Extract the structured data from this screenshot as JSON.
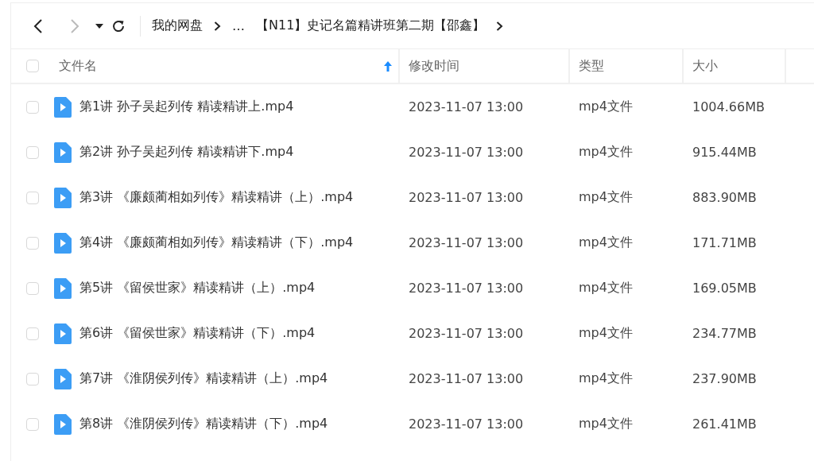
{
  "toolbar": {
    "back": {
      "disabled": false
    },
    "forward": {
      "disabled": true
    }
  },
  "breadcrumb": {
    "items": [
      "我的网盘",
      "…",
      "【N11】史记名篇精讲班第二期【邵鑫】"
    ]
  },
  "table": {
    "select_all": {
      "checked": false
    },
    "columns": [
      {
        "label": "文件名",
        "sorted": true
      },
      {
        "label": "修改时间",
        "sorted": false
      },
      {
        "label": "类型",
        "sorted": false
      },
      {
        "label": "大小",
        "sorted": false
      }
    ],
    "rows": [
      {
        "checked": false,
        "name": "第1讲 孙子吴起列传 精读精讲上.mp4",
        "modified": "2023-11-07 13:00",
        "type": "mp4文件",
        "size": "1004.66MB"
      },
      {
        "checked": false,
        "name": "第2讲 孙子吴起列传 精读精讲下.mp4",
        "modified": "2023-11-07 13:00",
        "type": "mp4文件",
        "size": "915.44MB"
      },
      {
        "checked": false,
        "name": "第3讲 《廉颇蔺相如列传》精读精讲（上）.mp4",
        "modified": "2023-11-07 13:00",
        "type": "mp4文件",
        "size": "883.90MB"
      },
      {
        "checked": false,
        "name": "第4讲 《廉颇蔺相如列传》精读精讲（下）.mp4",
        "modified": "2023-11-07 13:00",
        "type": "mp4文件",
        "size": "171.71MB"
      },
      {
        "checked": false,
        "name": "第5讲 《留侯世家》精读精讲（上）.mp4",
        "modified": "2023-11-07 13:00",
        "type": "mp4文件",
        "size": "169.05MB"
      },
      {
        "checked": false,
        "name": "第6讲 《留侯世家》精读精讲（下）.mp4",
        "modified": "2023-11-07 13:00",
        "type": "mp4文件",
        "size": "234.77MB"
      },
      {
        "checked": false,
        "name": "第7讲 《淮阴侯列传》精读精讲（上）.mp4",
        "modified": "2023-11-07 13:00",
        "type": "mp4文件",
        "size": "237.90MB"
      },
      {
        "checked": false,
        "name": "第8讲 《淮阴侯列传》精读精讲（下）.mp4",
        "modified": "2023-11-07 13:00",
        "type": "mp4文件",
        "size": "261.41MB"
      }
    ]
  }
}
